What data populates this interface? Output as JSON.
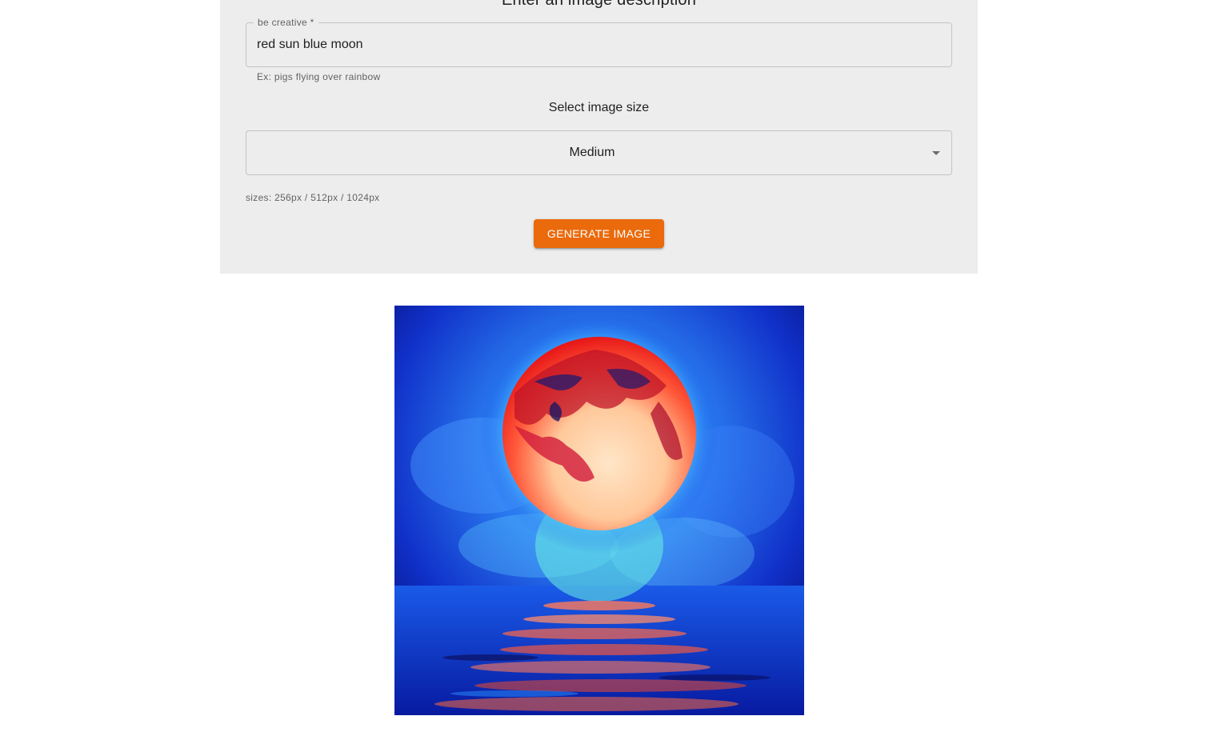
{
  "form": {
    "heading": "Enter an image description",
    "prompt_label": "be creative *",
    "prompt_value": "red sun blue moon",
    "prompt_helper": "Ex: pigs flying over rainbow",
    "size_label": "Select image size",
    "size_selected": "Medium",
    "sizes_hint": "sizes: 256px / 512px / 1024px",
    "generate_button_label": "GENERATE IMAGE"
  },
  "colors": {
    "panel_background": "#ededed",
    "button_accent": "#ea6a0c",
    "field_border": "#c4c4c4"
  },
  "result": {
    "image_description": "red moon over blue water",
    "icon": "generated-artwork"
  }
}
